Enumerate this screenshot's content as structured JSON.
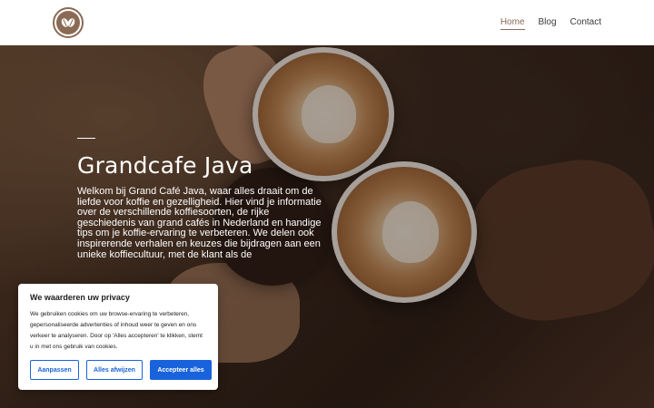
{
  "header": {
    "logo_icon": "coffee-beans-icon",
    "nav": [
      {
        "label": "Home",
        "active": true
      },
      {
        "label": "Blog",
        "active": false
      },
      {
        "label": "Contact",
        "active": false
      }
    ]
  },
  "hero": {
    "title": "Grandcafe Java",
    "text": "Welkom bij Grand Café Java, waar alles draait om de liefde voor koffie en gezelligheid. Hier vind je informatie over de verschillende koffiesoorten, de rijke geschiedenis van grand cafés in Nederland en handige tips om je koffie-ervaring te verbeteren. We delen ook inspirerende verhalen en keuzes die bijdragen aan een unieke koffiecultuur, met de klant als de"
  },
  "cookie_banner": {
    "title": "We waarderen uw privacy",
    "text": "We gebruiken cookies om uw browse-ervaring te verbeteren, gepersonaliseerde advertenties of inhoud weer te geven en ons verkeer te analyseren. Door op 'Alles accepteren' te klikken, stemt u in met ons gebruik van cookies.",
    "customize_label": "Aanpassen",
    "reject_label": "Alles afwijzen",
    "accept_label": "Accepteer alles",
    "accent_color": "#1863dc"
  },
  "colors": {
    "brand": "#8a6a55",
    "text": "#3a3a3a"
  }
}
